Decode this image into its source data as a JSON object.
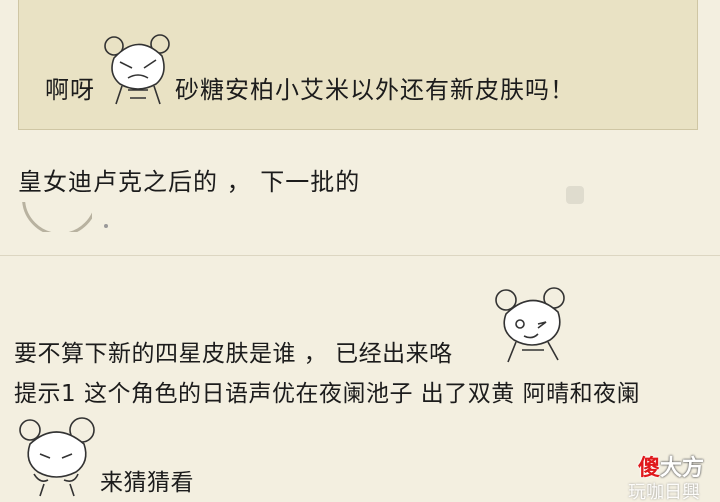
{
  "quote": {
    "prefix": "啊呀",
    "text": "砂糖安柏小艾米以外还有新皮肤吗！"
  },
  "post1": {
    "text": "皇女迪卢克之后的 ， 下一批的"
  },
  "post2": {
    "line1": "要不算下新的四星皮肤是谁 ， 已经出来咯",
    "line2": "提示1 这个角色的日语声优在夜阑池子 出了双黄 阿晴和夜阑",
    "line3": "来猜猜看"
  },
  "watermark": {
    "accent": "傻",
    "rest": "大方",
    "sub": "玩咖日興"
  },
  "colors": {
    "background": "#f3efe0",
    "quote_bg": "#e9e2c4",
    "accent_red": "#e0181c"
  },
  "icons": [
    "chibi-girl-sticker",
    "chibi-girl-wink-sticker",
    "chibi-girl-peek-sticker"
  ]
}
